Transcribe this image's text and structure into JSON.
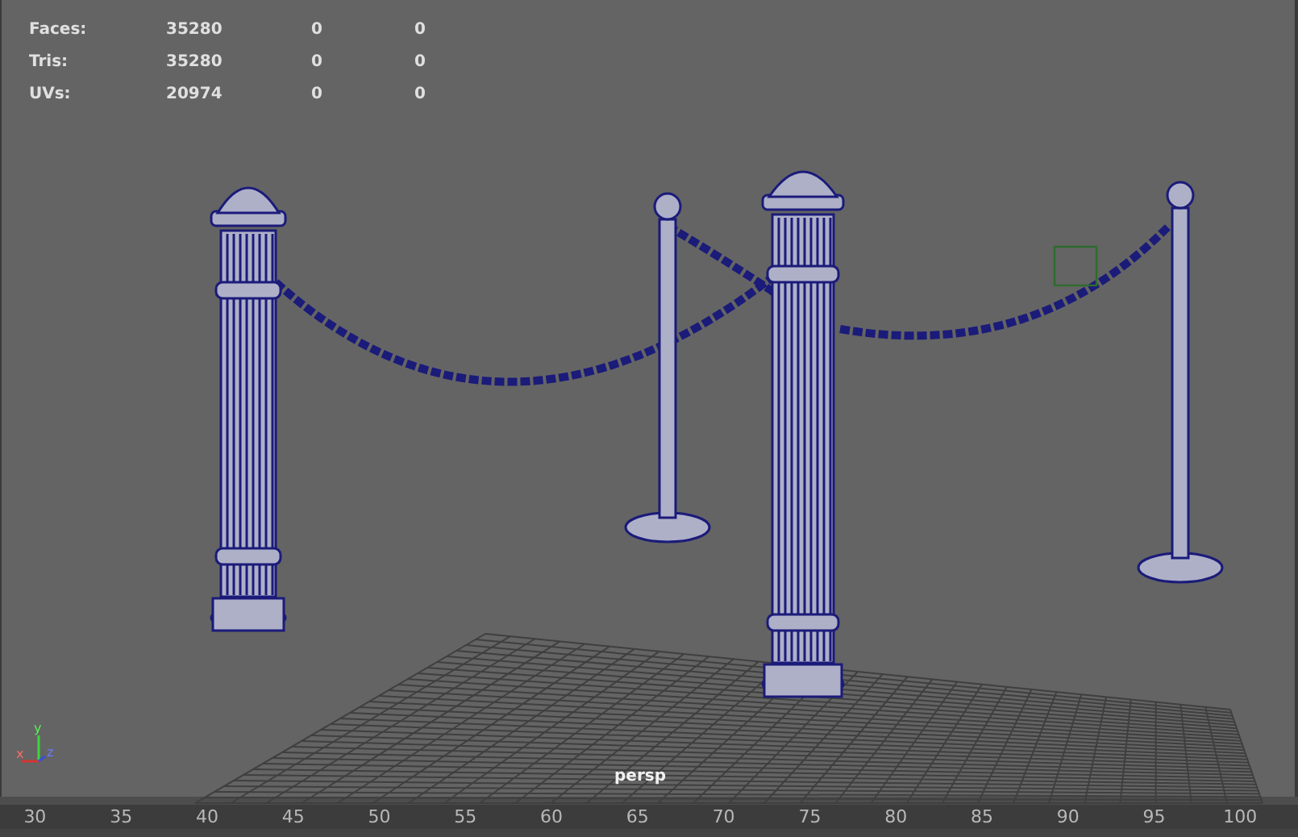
{
  "heads_up_display": {
    "rows": [
      {
        "label": "Faces:",
        "values": [
          "35280",
          "0",
          "0"
        ]
      },
      {
        "label": "Tris:",
        "values": [
          "35280",
          "0",
          "0"
        ]
      },
      {
        "label": "UVs:",
        "values": [
          "20974",
          "0",
          "0"
        ]
      }
    ]
  },
  "axis_gizmo": {
    "labels": [
      "x",
      "y",
      "z"
    ]
  },
  "camera_label": "persp",
  "timeline": {
    "ticks": [
      "30",
      "35",
      "40",
      "45",
      "50",
      "55",
      "60",
      "65",
      "70",
      "75",
      "80",
      "85",
      "90",
      "95",
      "100"
    ]
  }
}
